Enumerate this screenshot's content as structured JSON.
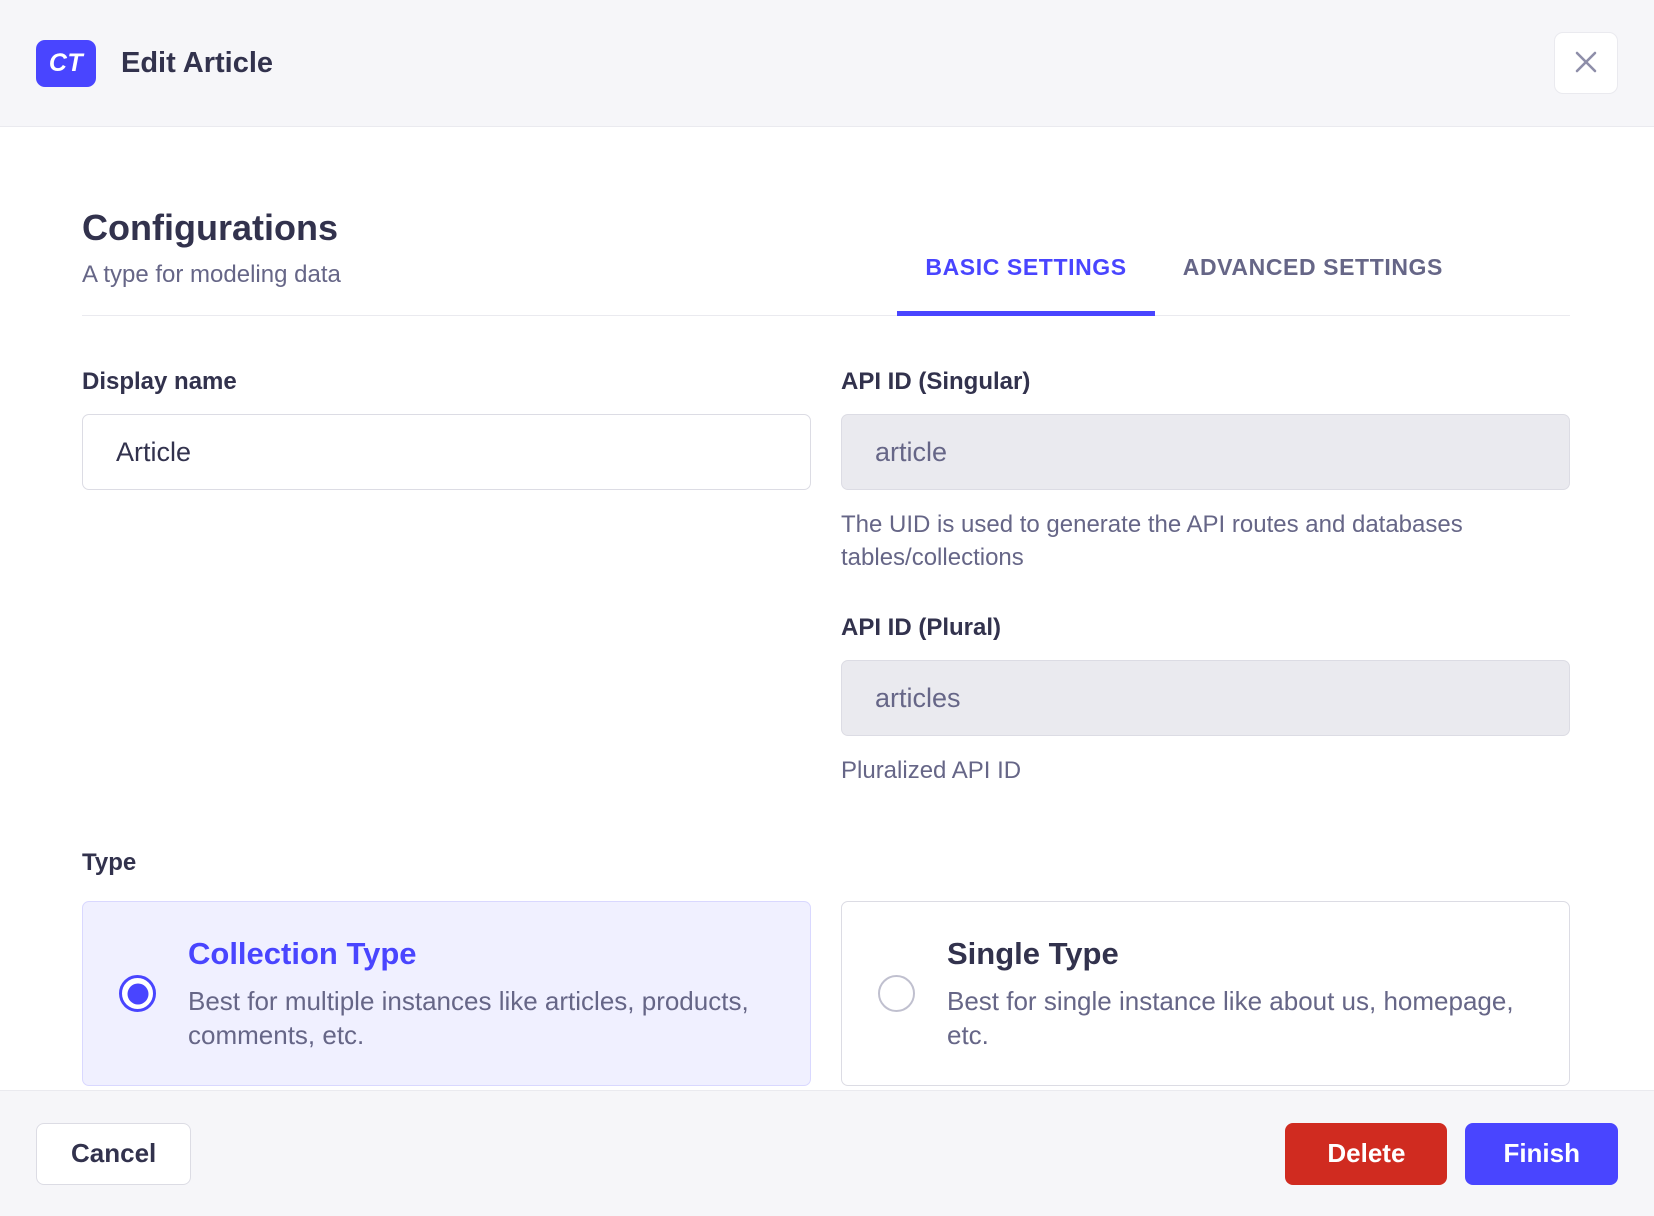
{
  "modal": {
    "badge": "CT",
    "title": "Edit Article"
  },
  "config": {
    "title": "Configurations",
    "subtitle": "A type for modeling data",
    "tabs": [
      {
        "label": "BASIC SETTINGS",
        "active": true
      },
      {
        "label": "ADVANCED SETTINGS",
        "active": false
      }
    ]
  },
  "form": {
    "display_name": {
      "label": "Display name",
      "value": "Article"
    },
    "api_id_singular": {
      "label": "API ID (Singular)",
      "value": "article",
      "hint": "The UID is used to generate the API routes and databases tables/collections"
    },
    "api_id_plural": {
      "label": "API ID (Plural)",
      "value": "articles",
      "hint": "Pluralized API ID"
    },
    "type": {
      "label": "Type",
      "options": [
        {
          "title": "Collection Type",
          "description": "Best for multiple instances like articles, products, comments, etc.",
          "selected": true
        },
        {
          "title": "Single Type",
          "description": "Best for single instance like about us, homepage, etc.",
          "selected": false
        }
      ]
    }
  },
  "footer": {
    "cancel_label": "Cancel",
    "delete_label": "Delete",
    "finish_label": "Finish"
  },
  "colors": {
    "primary": "#4945ff",
    "primary_light": "#f0f0ff",
    "danger": "#d02b20",
    "neutral_bg": "#f6f6f9"
  }
}
